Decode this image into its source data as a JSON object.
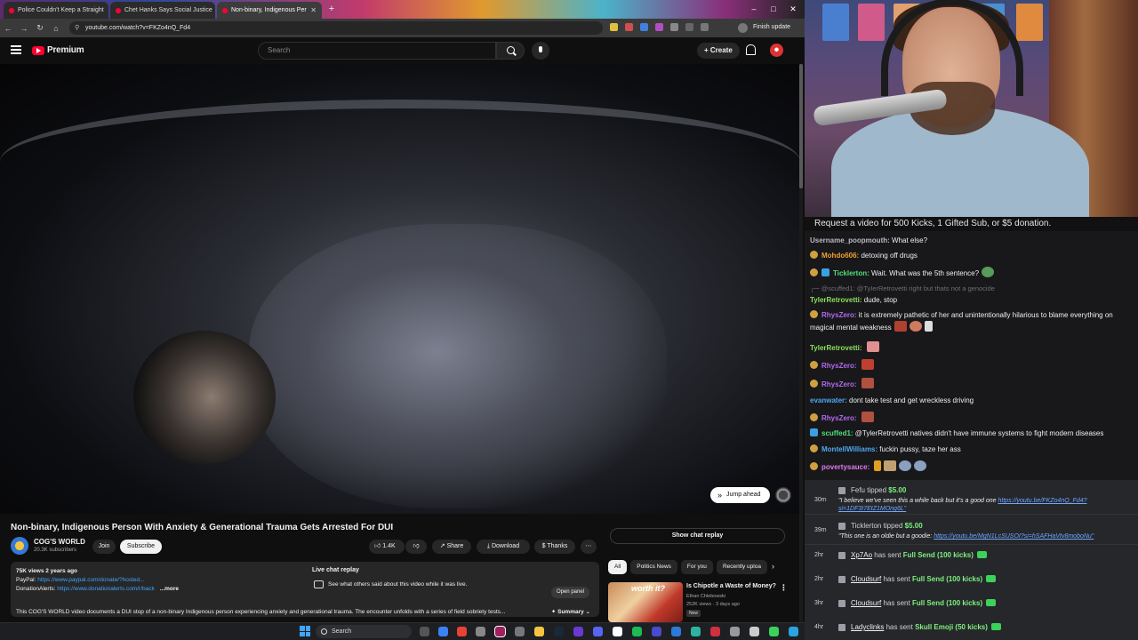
{
  "browser": {
    "tabs": [
      {
        "title": "Police Couldn't Keep a Straight"
      },
      {
        "title": "Chet Hanks Says Social Justice"
      },
      {
        "title": "Non-binary, Indigenous Per"
      }
    ],
    "url": "youtube.com/watch?v=FKZo4nQ_Fd4",
    "finish_update": "Finish update",
    "window_controls": [
      "–",
      "□",
      "✕"
    ]
  },
  "youtube": {
    "logo_text": "Premium",
    "search_placeholder": "Search",
    "create_label": "Create",
    "jump_ahead": "Jump ahead",
    "video_title": "Non-binary, Indigenous Person With Anxiety & Generational Trauma Gets Arrested For DUI",
    "channel": {
      "name": "COG'S WORLD",
      "subs": "20.3K subscribers"
    },
    "join_label": "Join",
    "subscribe_label": "Subscribe",
    "like_count": "1.4K",
    "share_label": "Share",
    "download_label": "Download",
    "thanks_label": "Thanks",
    "more_dots": "⋯",
    "description": {
      "stats": "75K views  2 years ago",
      "paypal_label": "PayPal:",
      "paypal_link": "https://www.paypal.com/donate/?hosted...",
      "donation_label": "DonationAlerts:",
      "donation_link": "https://www.donationalerts.com/r/back",
      "more": "...more",
      "body": "This COG'S WORLD video documents a DUI stop of a non-binary Indigenous person experiencing anxiety and generational trauma. The encounter unfolds with a series of field sobriety tests...",
      "summary": "Summary"
    },
    "live_chat_replay": {
      "heading": "Live chat replay",
      "text": "See what others said about this video while it was live.",
      "open_panel": "Open panel"
    },
    "show_chat_replay": "Show chat replay",
    "chips": [
      "All",
      "Politics News",
      "For you",
      "Recently uploa"
    ],
    "recommended": {
      "thumb_text": "worth it?",
      "title": "Is Chipotle a Waste of Money?",
      "channel": "Ethan Chlebowski",
      "meta": "252K views · 3 days ago",
      "badge": "New"
    }
  },
  "taskbar": {
    "search_label": "Search"
  },
  "stream": {
    "banner": "Request a video for 500 Kicks, 1 Gifted Sub, or $5 donation.",
    "chat": [
      {
        "user": "Username_poopmouth:",
        "text": "What else?",
        "color": "#b9b9c2"
      },
      {
        "user": "Mohdo606:",
        "text": "detoxing off drugs",
        "color": "#f0a030"
      },
      {
        "user": "Ticklerton:",
        "text": "Wait. What was the 5th sentence?",
        "color": "#4fe07a"
      },
      {
        "user": "@scuffed1: @TyIerRetrovetti",
        "text": "right but thats not a genocide",
        "color": "#6d6d75"
      },
      {
        "user": "TylerRetrovetti:",
        "text": "dude, stop",
        "color": "#8be05a"
      },
      {
        "user": "RhysZero:",
        "text": "it is extremely pathetic of her and unintentionally hilarious to blame everything on magical mental weakness",
        "color": "#b06af0"
      },
      {
        "user": "TylerRetrovetti:",
        "text": "",
        "color": "#8be05a"
      },
      {
        "user": "RhysZero:",
        "text": "",
        "color": "#b06af0"
      },
      {
        "user": "RhysZero:",
        "text": "",
        "color": "#b06af0"
      },
      {
        "user": "evanwater:",
        "text": "dont take test and get wreckless driving",
        "color": "#4fa8f0"
      },
      {
        "user": "RhysZero:",
        "text": "",
        "color": "#b06af0"
      },
      {
        "user": "scuffed1:",
        "text": "@TylerRetrovetti natives didn't have immune systems to fight modern diseases",
        "color": "#4fe07a"
      },
      {
        "user": "MontellWilliams:",
        "text": "fuckin pussy, taze her ass",
        "color": "#4fa8f0"
      },
      {
        "user": "povertysauce:",
        "text": "",
        "color": "#e07af0"
      }
    ],
    "tips": [
      {
        "time": "30m",
        "name": "Fefu",
        "verb": "tipped",
        "amount": "$5.00",
        "quote": "\"I believe we've seen this a while back but it's a good one",
        "link": "https://youtu.be/FKZo4nQ_Fd4?si=1DF3I7EtZ1MOng6L\""
      },
      {
        "time": "39m",
        "name": "Ticklerton",
        "verb": "tipped",
        "amount": "$5.00",
        "quote": "\"This one is an oldie but a goodie:",
        "link": "https://youtu.be/MgN1LcSUSOI?si=hSAFHaVtv8moboNu\""
      },
      {
        "time": "2hr",
        "name": "Xp7Ao",
        "verb": "has sent",
        "amount": "Full Send (100 kicks)"
      },
      {
        "time": "2hr",
        "name": "Cloudsurf",
        "verb": "has sent",
        "amount": "Full Send (100 kicks)"
      },
      {
        "time": "3hr",
        "name": "Cloudsurf",
        "verb": "has sent",
        "amount": "Full Send (100 kicks)"
      },
      {
        "time": "4hr",
        "name": "Ladyclinks",
        "verb": "has sent",
        "amount": "Skull Emoji (50 kicks)"
      }
    ]
  }
}
